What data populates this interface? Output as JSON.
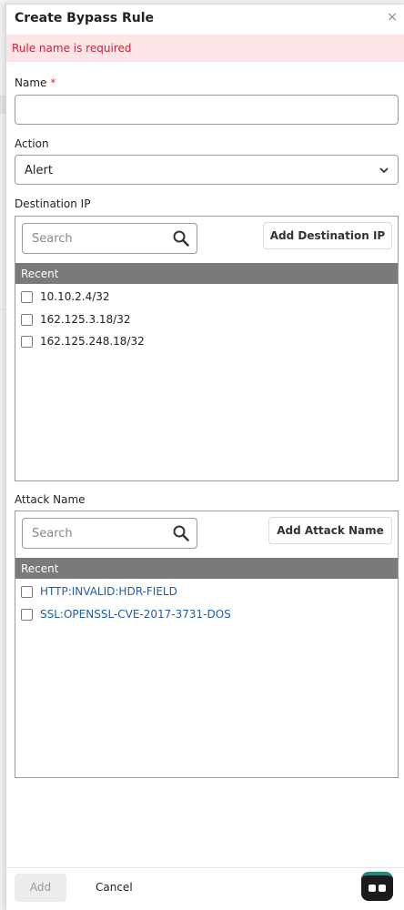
{
  "dialog": {
    "title": "Create Bypass Rule",
    "close_glyph": "×",
    "error": "Rule name is required"
  },
  "name_field": {
    "label": "Name",
    "required_mark": "*",
    "value": ""
  },
  "action_field": {
    "label": "Action",
    "value": "Alert"
  },
  "destination_ip": {
    "label": "Destination IP",
    "search_placeholder": "Search",
    "add_button": "Add Destination IP",
    "recent_header": "Recent",
    "items": [
      "10.10.2.4/32",
      "162.125.3.18/32",
      "162.125.248.18/32"
    ]
  },
  "attack_name": {
    "label": "Attack Name",
    "search_placeholder": "Search",
    "add_button": "Add Attack Name",
    "recent_header": "Recent",
    "items": [
      "HTTP:INVALID:HDR-FIELD",
      "SSL:OPENSSL-CVE-2017-3731-DOS"
    ]
  },
  "footer": {
    "add_label": "Add",
    "cancel_label": "Cancel"
  },
  "colors": {
    "error_bg": "#fde4e6",
    "error_text": "#c4253b",
    "recent_header_bg": "#7a7a7a",
    "link_text": "#1f5fa8"
  }
}
